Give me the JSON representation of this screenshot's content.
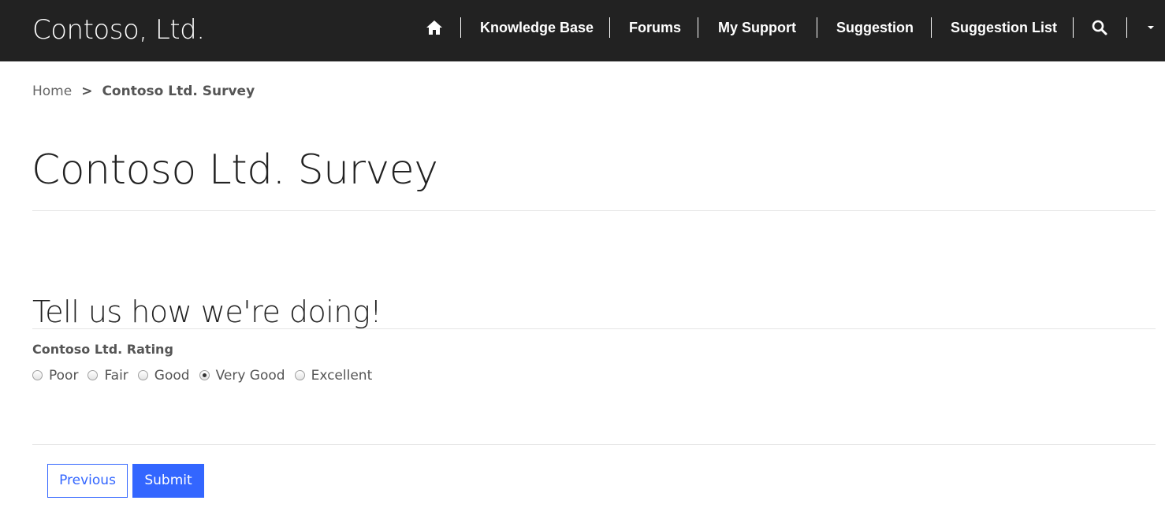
{
  "header": {
    "brand": "Contoso, Ltd.",
    "nav_items": [
      {
        "label": "Knowledge Base"
      },
      {
        "label": "Forums"
      },
      {
        "label": "My Support"
      },
      {
        "label": "Suggestion"
      },
      {
        "label": "Suggestion List"
      }
    ],
    "icons": {
      "home": "home-icon",
      "search": "search-icon",
      "caret": "caret-down-icon"
    }
  },
  "breadcrumb": {
    "home": "Home",
    "separator": ">",
    "current": "Contoso Ltd. Survey"
  },
  "page": {
    "title": "Contoso Ltd. Survey"
  },
  "survey": {
    "section_title": "Tell us how we're doing!",
    "field_label": "Contoso Ltd. Rating",
    "options": [
      {
        "label": "Poor",
        "selected": false
      },
      {
        "label": "Fair",
        "selected": false
      },
      {
        "label": "Good",
        "selected": false
      },
      {
        "label": "Very Good",
        "selected": true
      },
      {
        "label": "Excellent",
        "selected": false
      }
    ]
  },
  "buttons": {
    "previous": "Previous",
    "submit": "Submit"
  },
  "colors": {
    "topbar": "#222222",
    "accent": "#3366ff"
  }
}
